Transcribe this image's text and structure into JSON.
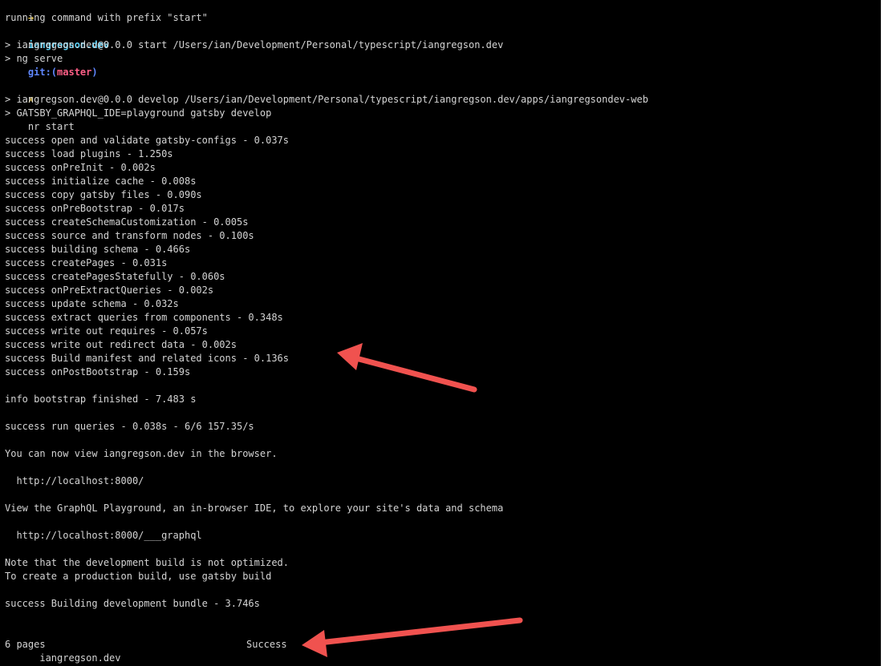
{
  "prompt": {
    "arrow": "→",
    "directory": "iangregson.dev",
    "git_label": "git:(",
    "branch": "master",
    "git_close": ")",
    "dirty": "✗",
    "command": "nr start"
  },
  "lines": {
    "l1": "running command with prefix \"start\"",
    "l3": "> iangregson.dev@0.0.0 start /Users/ian/Development/Personal/typescript/iangregson.dev",
    "l4": "> ng serve",
    "l7": "> iangregson.dev@0.0.0 develop /Users/ian/Development/Personal/typescript/iangregson.dev/apps/iangregsondev-web",
    "l8": "> GATSBY_GRAPHQL_IDE=playground gatsby develop",
    "l10": "success open and validate gatsby-configs - 0.037s",
    "l11": "success load plugins - 1.250s",
    "l12": "success onPreInit - 0.002s",
    "l13": "success initialize cache - 0.008s",
    "l14": "success copy gatsby files - 0.090s",
    "l15": "success onPreBootstrap - 0.017s",
    "l16": "success createSchemaCustomization - 0.005s",
    "l17": "success source and transform nodes - 0.100s",
    "l18": "success building schema - 0.466s",
    "l19": "success createPages - 0.031s",
    "l20": "success createPagesStatefully - 0.060s",
    "l21": "success onPreExtractQueries - 0.002s",
    "l22": "success update schema - 0.032s",
    "l23": "success extract queries from components - 0.348s",
    "l24": "success write out requires - 0.057s",
    "l25": "success write out redirect data - 0.002s",
    "l26": "success Build manifest and related icons - 0.136s",
    "l27": "success onPostBootstrap - 0.159s",
    "l29": "info bootstrap finished - 7.483 s",
    "l31": "success run queries - 0.038s - 6/6 157.35/s",
    "l33": "You can now view iangregson.dev in the browser.",
    "l35": "  http://localhost:8000/",
    "l37": "View the GraphQL Playground, an in-browser IDE, to explore your site's data and schema",
    "l39": "  http://localhost:8000/___graphql",
    "l41": "Note that the development build is not optimized.",
    "l42": "To create a production build, use gatsby build",
    "l44": "success Building development bundle - 3.746s"
  },
  "status": {
    "pages": "6 pages",
    "result": "Success",
    "site": "      iangregson.dev"
  },
  "colors": {
    "background": "#000000",
    "text": "#d4d4d4",
    "annotation_arrow": "#f0524f"
  }
}
